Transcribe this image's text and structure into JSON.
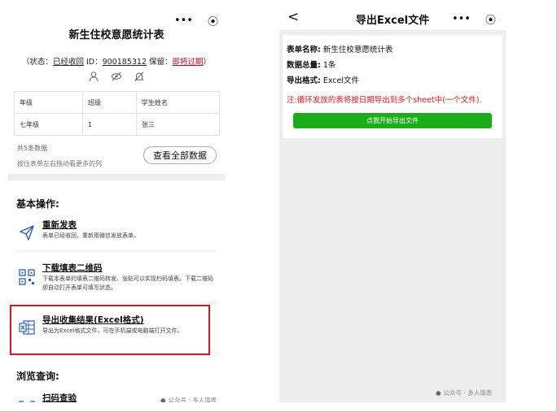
{
  "left": {
    "form_title": "新生住校意愿统计表",
    "status": {
      "open_paren": "（状态：",
      "state": "已经收回",
      "id_label": " ID：",
      "id": "900185312",
      "keep_label": " 保留：",
      "keep": "即将过期",
      "close_paren": "）"
    },
    "table": {
      "headers": [
        "年级",
        "班级",
        "学生姓名"
      ],
      "rows": [
        [
          "七年级",
          "1",
          "张三"
        ]
      ]
    },
    "count_text": "共5条数据",
    "scroll_hint": "按住表单左右拖动看更多的列",
    "view_all_label": "查看全部数据",
    "section_basic": "基本操作:",
    "items": [
      {
        "title": "重新发表",
        "desc": "表单已经收回，重新用微信发放表单。",
        "icon": "send-icon"
      },
      {
        "title": "下载填表二维码",
        "desc": "下载本表单的填表二维码转发、张贴可以实现扫码填表。下载二维码即自动打开表单可填写状态。",
        "icon": "qr-code-icon"
      },
      {
        "title": "导出收集结果(Excel格式)",
        "desc": "导出为Excel格式文件，可在手机端或电脑端打开文件。",
        "icon": "excel-icon"
      }
    ],
    "section_browse": "浏览查询:",
    "scan_title": "扫码查验",
    "watermark": "公众号 · 多人填表"
  },
  "right": {
    "back": "<",
    "title": "导出Excel文件",
    "form_name_label": "表单名称:",
    "form_name": "新生住校意愿统计表",
    "total_label": "数据总量:",
    "total": "1条",
    "format_label": "导出格式:",
    "format": "Excel文件",
    "note": "注:循环发放的表将按日期导出到多个sheet中(一个文件).",
    "start_button": "点我开始导出文件",
    "watermark": "公众号 · 多人填表"
  },
  "capsule": {
    "more": "•••",
    "close": "⦿"
  },
  "colors": {
    "accent_red": "#e0141e",
    "green": "#1aad19",
    "icon_blue": "#2b5fb4"
  }
}
